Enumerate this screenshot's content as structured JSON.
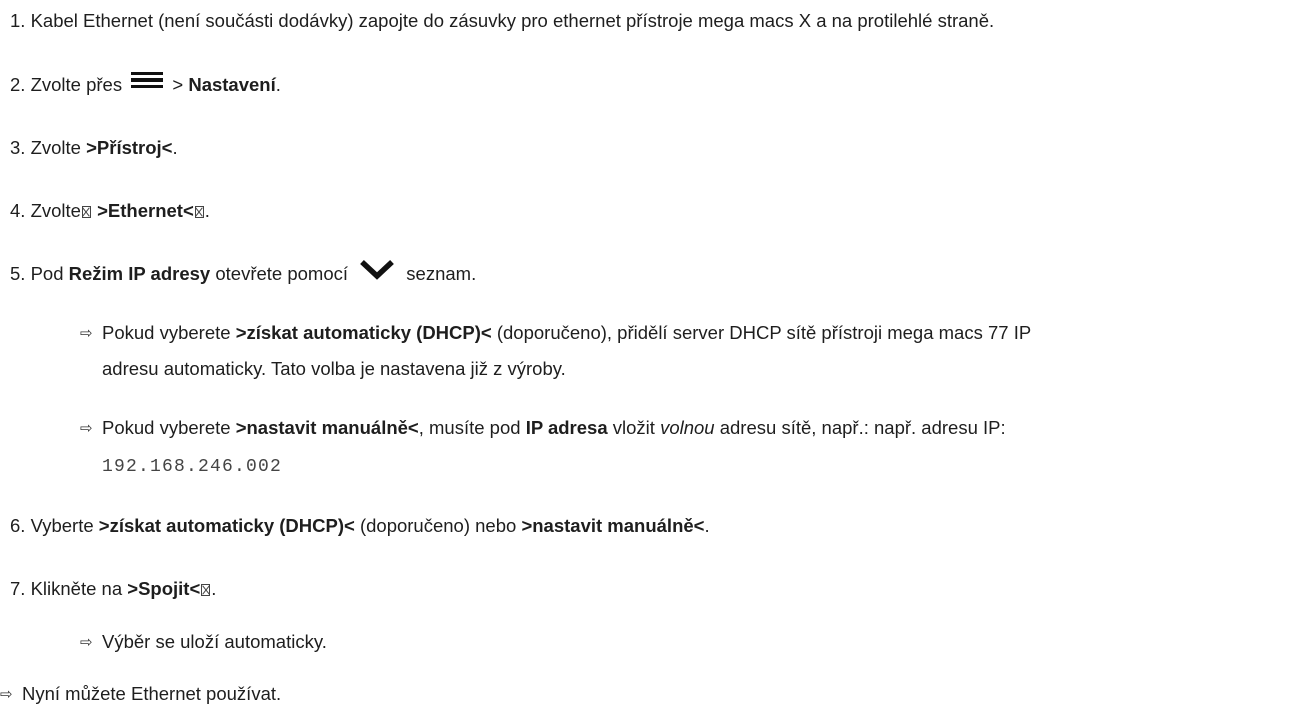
{
  "steps": [
    {
      "num": "1.",
      "text": "Kabel Ethernet (není součásti dodávky) zapojte do zásuvky pro ethernet přístroje mega macs X a na protilehlé straně."
    },
    {
      "num": "2.",
      "pre": "Zvolte přes",
      "sep": ">",
      "bold": "Nastavení",
      "post": "."
    },
    {
      "num": "3.",
      "pre": "Zvolte",
      "bold": ">Přístroj<",
      "post": "."
    },
    {
      "num": "4.",
      "pre": "Zvolte",
      "bold_a": ">Ethernet<",
      "post": "."
    },
    {
      "num": "5.",
      "pre": "Pod",
      "bold": "Režim IP adresy",
      "mid": "otevřete pomocí",
      "post": "seznam."
    },
    {
      "num": "6.",
      "pre": "Vyberte",
      "bold_a": ">získat automaticky (DHCP)<",
      "mid": "(doporučeno) nebo",
      "bold_b": ">nastavit manuálně<",
      "post": "."
    },
    {
      "num": "7.",
      "pre": "Klikněte na",
      "bold_a": ">Spojit<",
      "post": "."
    }
  ],
  "results": {
    "r1": {
      "pre": "Pokud vyberete",
      "bold": ">získat automaticky (DHCP)<",
      "line1_post": "(doporučeno), přidělí server DHCP sítě přístroji mega macs 77 IP",
      "line2": "adresu automaticky. Tato volba je nastavena již z výroby."
    },
    "r2": {
      "pre": "Pokud vyberete",
      "bold_a": ">nastavit manuálně<",
      "mid_a": ", musíte pod",
      "bold_b": "IP adresa",
      "mid_b": "vložit",
      "italic": "volnou",
      "post": "adresu sítě, např.: např. adresu IP:",
      "code": "192.168.246.002"
    },
    "r3": "Výběr se uloží automaticky.",
    "final": "Nyní můžete Ethernet používat."
  },
  "icons": {
    "arrow": "result-arrow-icon",
    "menu": "hamburger-menu-icon",
    "chevron": "chevron-down-icon",
    "placeholder": "missing-glyph-box-icon"
  }
}
